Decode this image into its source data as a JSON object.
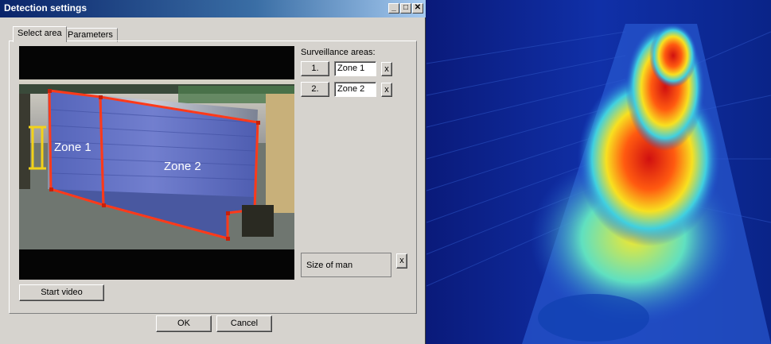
{
  "window": {
    "title": "Detection settings",
    "minimize": "_",
    "maximize": "□",
    "close": "✕"
  },
  "tabs": [
    "Select area",
    "Parameters"
  ],
  "video": {
    "zones_overlay": [
      "Zone 1",
      "Zone 2"
    ],
    "start_button": "Start video"
  },
  "surveillance": {
    "label": "Surveillance areas:",
    "rows": [
      {
        "index": "1.",
        "name": "Zone 1",
        "remove": "x"
      },
      {
        "index": "2.",
        "name": "Zone 2",
        "remove": "x"
      }
    ]
  },
  "size_of_man": {
    "label": "Size of man",
    "remove": "x"
  },
  "footer": {
    "ok": "OK",
    "cancel": "Cancel"
  },
  "colors": {
    "zone_outline": "#ff3a1a",
    "zone_fill": "#2a40c8",
    "title_bar": "#0a246a",
    "marker": "#f2d21a"
  }
}
